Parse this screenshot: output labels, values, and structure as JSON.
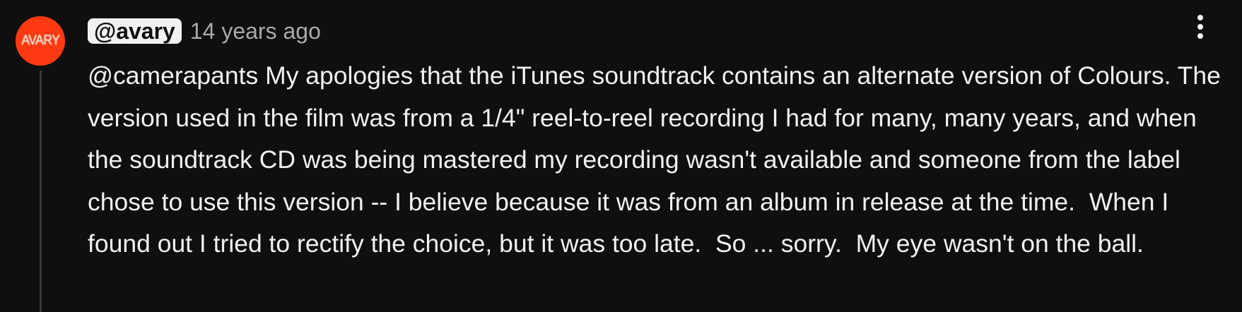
{
  "comment": {
    "avatar_text": "AVARY",
    "author": "@avary",
    "timestamp": "14 years ago",
    "menu_icon": "more-vertical-icon",
    "text": "@camerapants My apologies that the iTunes soundtrack contains an alternate version of Colours. The version used in the film was from a 1/4\" reel-to-reel recording I had for many, many years, and when the soundtrack CD was being mastered my recording wasn't available and someone from the label chose to use this version -- I believe because it was from an album in release at the time.  When I found out I tried to rectify the choice, but it was too late.  So ... sorry.  My eye wasn't on the ball."
  },
  "theme": {
    "background": "#0f0f0f",
    "text_primary": "#f1f1f1",
    "text_secondary": "#aaaaaa",
    "avatar_color": "#ff3a12",
    "thread_line": "#3a3a3a"
  }
}
